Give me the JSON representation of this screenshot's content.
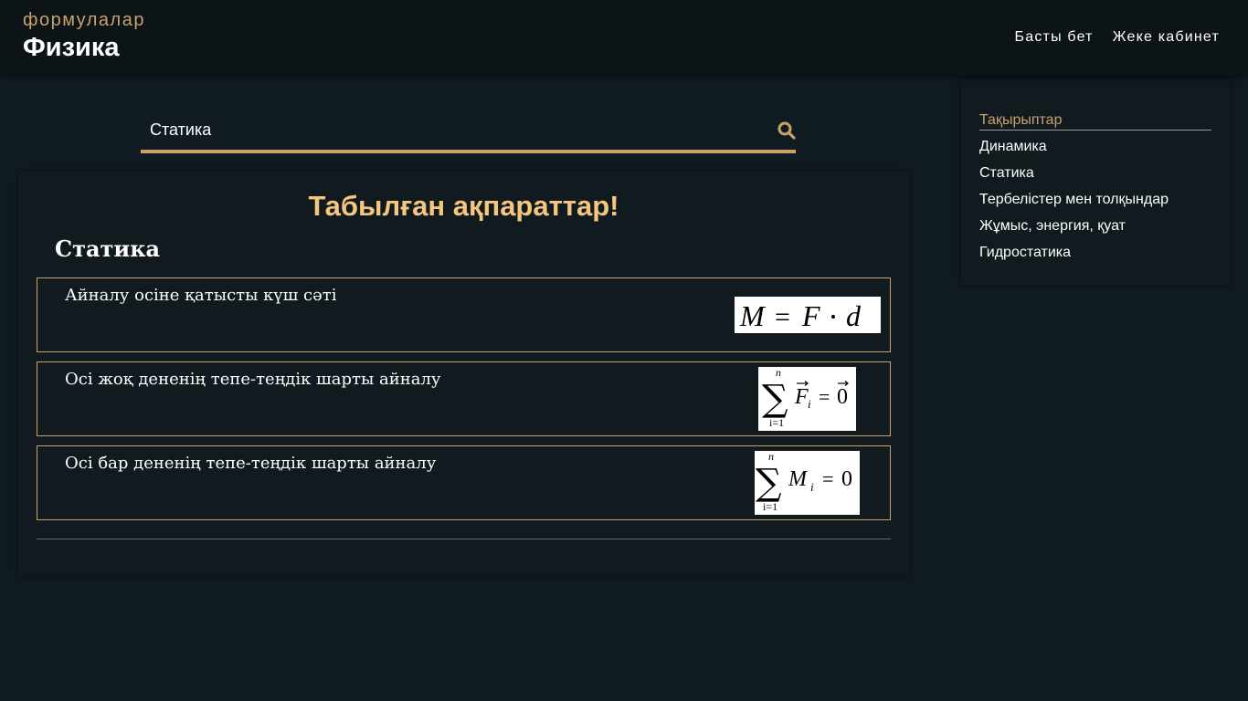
{
  "header": {
    "subtitle": "формулалар",
    "title": "Физика",
    "nav": [
      {
        "label": "Басты бет"
      },
      {
        "label": "Жеке кабинет"
      }
    ]
  },
  "search": {
    "value": "Статика",
    "icon": "search-icon"
  },
  "results": {
    "title": "Табылған ақпараттар!",
    "section": "Статика",
    "items": [
      {
        "name": "Айналу осіне қатысты күш сәті",
        "formula": "M = F · d"
      },
      {
        "name": "Осі жоқ дененің тепе-теңдік шарты айналу",
        "formula": "∑ (i=1..n) F⃗i = 0⃗"
      },
      {
        "name": "Осі бар дененің тепе-теңдік шарты айналу",
        "formula": "∑ (i=1..n) Mi = 0"
      }
    ]
  },
  "sidebar": {
    "heading": "Тақырыптар",
    "items": [
      {
        "label": "Динамика"
      },
      {
        "label": "Статика"
      },
      {
        "label": "Тербелістер мен толқындар"
      },
      {
        "label": "Жұмыс, энергия, қуат"
      },
      {
        "label": "Гидростатика"
      }
    ]
  },
  "colors": {
    "accent": "#c7a36a",
    "results_title": "#f5c77e",
    "background": "#101c22",
    "panel": "#111a1f",
    "header": "#0c1418"
  }
}
